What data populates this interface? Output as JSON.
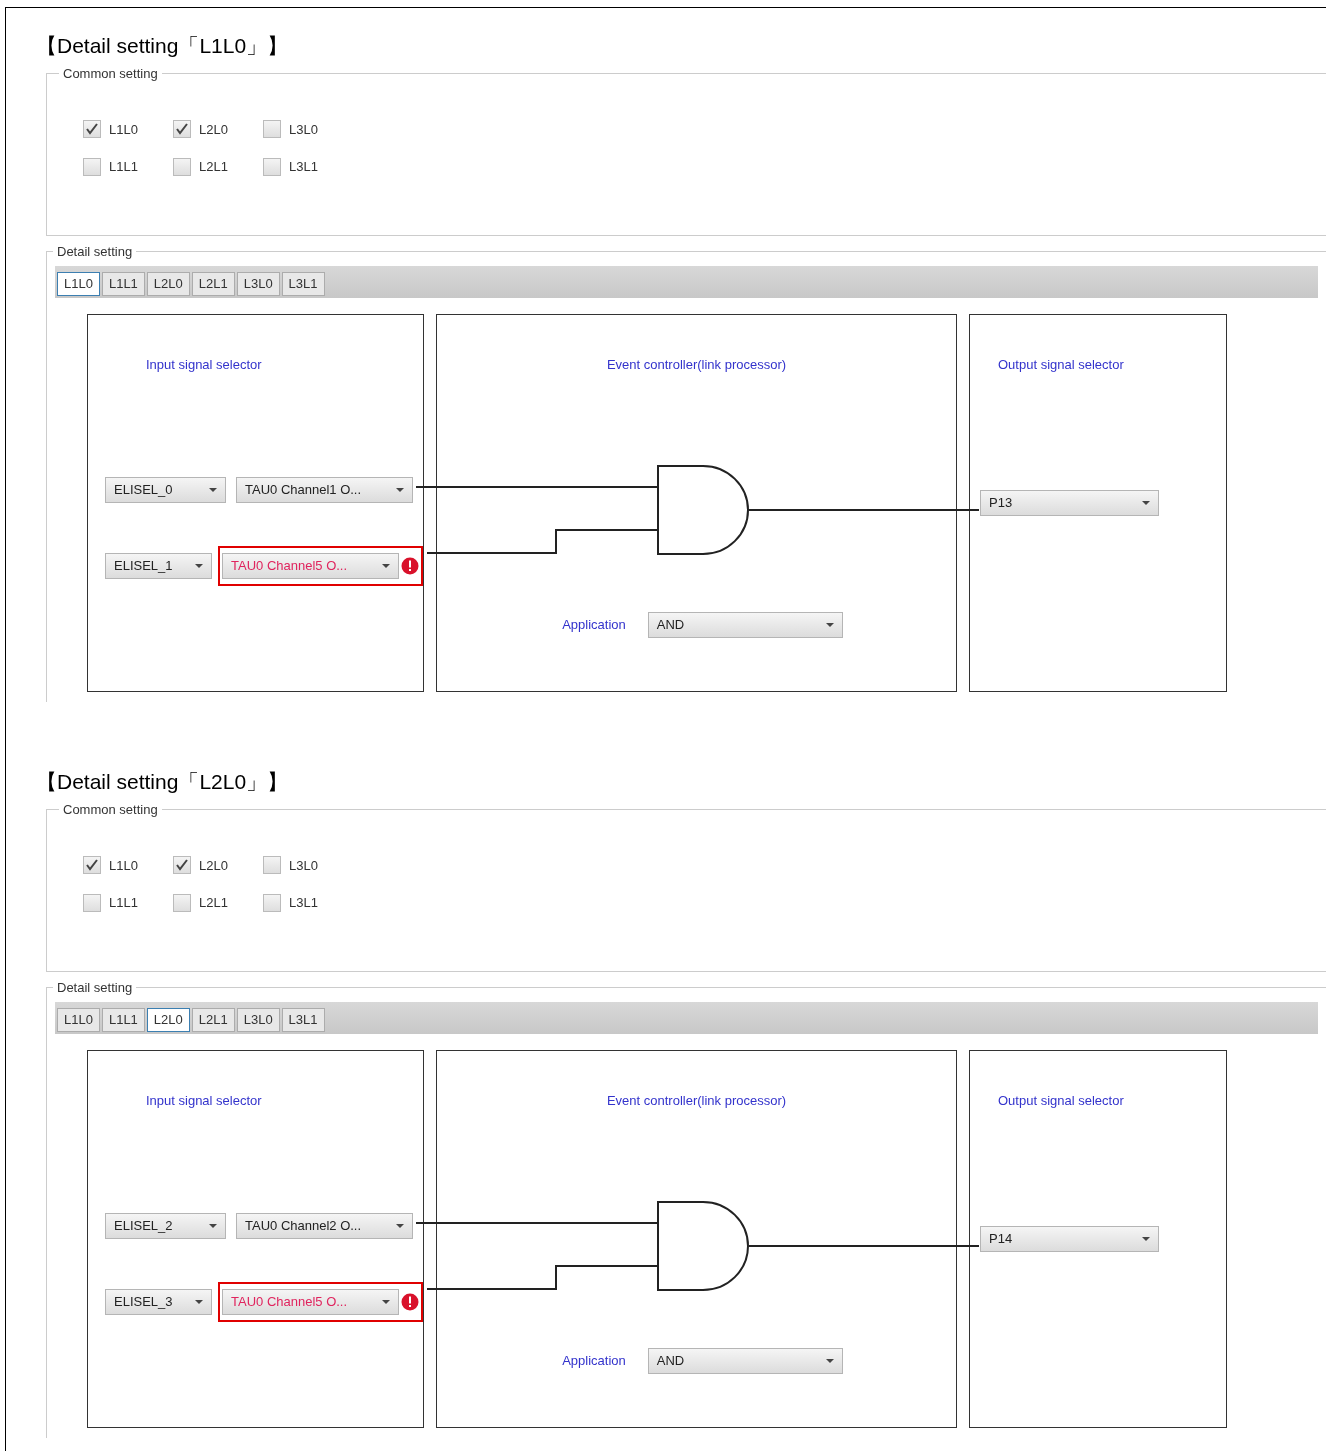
{
  "sections": [
    {
      "heading": "【Detail setting「L1L0」】",
      "common": {
        "legend": "Common setting",
        "checkboxes": [
          {
            "label": "L1L0",
            "checked": true
          },
          {
            "label": "L2L0",
            "checked": true
          },
          {
            "label": "L3L0",
            "checked": false
          },
          {
            "label": "L1L1",
            "checked": false
          },
          {
            "label": "L2L1",
            "checked": false
          },
          {
            "label": "L3L1",
            "checked": false
          }
        ]
      },
      "detail": {
        "legend": "Detail setting",
        "tabs": [
          {
            "label": "L1L0",
            "selected": true
          },
          {
            "label": "L1L1",
            "selected": false
          },
          {
            "label": "L2L0",
            "selected": false
          },
          {
            "label": "L2L1",
            "selected": false
          },
          {
            "label": "L3L0",
            "selected": false
          },
          {
            "label": "L3L1",
            "selected": false
          }
        ],
        "input": {
          "title": "Input signal selector",
          "rows": [
            {
              "selector": "ELISEL_0",
              "signal": "TAU0 Channel1 O...",
              "error": false
            },
            {
              "selector": "ELISEL_1",
              "signal": "TAU0 Channel5 O...",
              "error": true
            }
          ]
        },
        "controller": {
          "title": "Event controller(link processor)",
          "application_label": "Application",
          "application_value": "AND"
        },
        "output": {
          "title": "Output signal selector",
          "value": "P13"
        }
      }
    },
    {
      "heading": "【Detail setting「L2L0」】",
      "common": {
        "legend": "Common setting",
        "checkboxes": [
          {
            "label": "L1L0",
            "checked": true
          },
          {
            "label": "L2L0",
            "checked": true
          },
          {
            "label": "L3L0",
            "checked": false
          },
          {
            "label": "L1L1",
            "checked": false
          },
          {
            "label": "L2L1",
            "checked": false
          },
          {
            "label": "L3L1",
            "checked": false
          }
        ]
      },
      "detail": {
        "legend": "Detail setting",
        "tabs": [
          {
            "label": "L1L0",
            "selected": false
          },
          {
            "label": "L1L1",
            "selected": false
          },
          {
            "label": "L2L0",
            "selected": true
          },
          {
            "label": "L2L1",
            "selected": false
          },
          {
            "label": "L3L0",
            "selected": false
          },
          {
            "label": "L3L1",
            "selected": false
          }
        ],
        "input": {
          "title": "Input signal selector",
          "rows": [
            {
              "selector": "ELISEL_2",
              "signal": "TAU0 Channel2 O...",
              "error": false
            },
            {
              "selector": "ELISEL_3",
              "signal": "TAU0 Channel5 O...",
              "error": true
            }
          ]
        },
        "controller": {
          "title": "Event controller(link processor)",
          "application_label": "Application",
          "application_value": "AND"
        },
        "output": {
          "title": "Output signal selector",
          "value": "P14"
        }
      }
    }
  ]
}
